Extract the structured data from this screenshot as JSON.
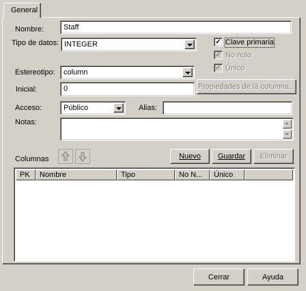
{
  "tabs": [
    {
      "label": "General"
    }
  ],
  "form": {
    "nombre_label": "Nombre:",
    "nombre_value": "Staff",
    "tipo_label": "Tipo de datos:",
    "tipo_value": "INTEGER",
    "clave_label": "Clave primaria",
    "clave_checked": true,
    "nonulo_label": "No nulo",
    "nonulo_checked": true,
    "unico_label": "Único",
    "unico_checked": true,
    "estereotipo_label": "Estereotipo:",
    "estereotipo_value": "column",
    "inicial_label": "Inicial:",
    "inicial_value": "0",
    "propiedades_button": "Propiedades de la columna...",
    "acceso_label": "Acceso:",
    "acceso_value": "Público",
    "alias_label": "Alias:",
    "alias_value": "",
    "notas_label": "Notas:",
    "notas_value": ""
  },
  "columnas": {
    "label": "Columnas",
    "nuevo_button": "Nuevo",
    "guardar_button": "Guardar",
    "eliminar_button": "Eliminar",
    "headers": [
      "PK",
      "Nombre",
      "Tipo",
      "No N...",
      "Único"
    ],
    "rows": []
  },
  "footer": {
    "cerrar_button": "Cerrar",
    "ayuda_button": "Ayuda"
  }
}
